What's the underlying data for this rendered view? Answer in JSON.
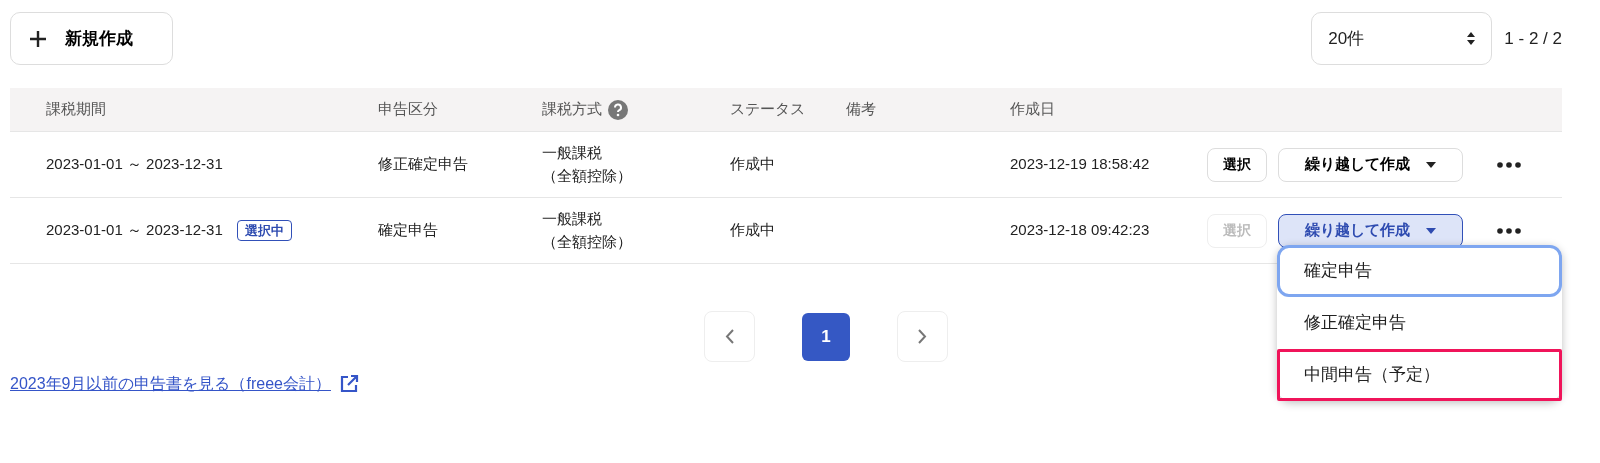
{
  "toolbar": {
    "new_button": "新規作成",
    "page_size": "20件",
    "range": "1 - 2 / 2"
  },
  "table": {
    "columns": [
      {
        "label": "課税期間"
      },
      {
        "label": "申告区分"
      },
      {
        "label": "課税方式",
        "help": true
      },
      {
        "label": "ステータス"
      },
      {
        "label": "備考"
      },
      {
        "label": "作成日"
      }
    ],
    "rows": [
      {
        "period": "2023-01-01 ～ 2023-12-31",
        "type": "修正確定申告",
        "tax_method": [
          "一般課税",
          "（全額控除）"
        ],
        "status": "作成中",
        "created": "2023-12-19 18:58:42",
        "select_button": {
          "label": "選択",
          "disabled": false
        },
        "carry_button": {
          "label": "繰り越して作成",
          "expanded": false
        }
      },
      {
        "period": "2023-01-01 ～ 2023-12-31",
        "badge": "選択中",
        "type": "確定申告",
        "tax_method": [
          "一般課税",
          "（全額控除）"
        ],
        "status": "作成中",
        "created": "2023-12-18 09:42:23",
        "select_button": {
          "label": "選択",
          "disabled": true
        },
        "carry_button": {
          "label": "繰り越して作成",
          "expanded": true
        }
      }
    ]
  },
  "dropdown": {
    "items": [
      {
        "label": "確定申告",
        "focused": true,
        "highlighted": false
      },
      {
        "label": "修正確定申告",
        "focused": false,
        "highlighted": false
      },
      {
        "label": "中間申告（予定）",
        "focused": false,
        "highlighted": true
      }
    ]
  },
  "pagination": {
    "pages": [
      {
        "label": "1",
        "selected": true
      }
    ]
  },
  "link": "2023年9月以前の申告書を見る（freee会計）"
}
